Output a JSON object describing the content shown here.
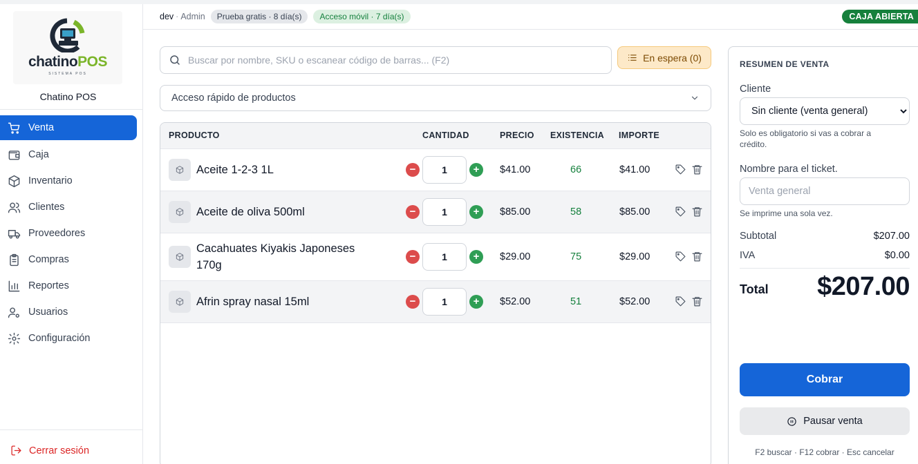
{
  "brand": {
    "logo_word_a": "chatino",
    "logo_word_b": "POS",
    "logo_sub": "SISTEMA POS",
    "name": "Chatino POS"
  },
  "sidebar": {
    "items": [
      {
        "label": "Venta",
        "icon": "cart-icon",
        "active": true
      },
      {
        "label": "Caja",
        "icon": "wallet-icon"
      },
      {
        "label": "Inventario",
        "icon": "box-icon"
      },
      {
        "label": "Clientes",
        "icon": "users-icon"
      },
      {
        "label": "Proveedores",
        "icon": "truck-icon"
      },
      {
        "label": "Compras",
        "icon": "clipboard-icon"
      },
      {
        "label": "Reportes",
        "icon": "bar-chart-icon"
      },
      {
        "label": "Usuarios",
        "icon": "user-cog-icon"
      },
      {
        "label": "Configuración",
        "icon": "gear-icon"
      }
    ],
    "logout": "Cerrar sesión"
  },
  "header": {
    "user": "dev",
    "separator": "·",
    "role": "Admin",
    "trial": "Prueba gratis · 8 día(s)",
    "mobile": "Acceso móvil · 7 día(s)",
    "cash_status": "CAJA ABIERTA"
  },
  "search": {
    "placeholder": "Buscar por nombre, SKU o escanear código de barras... (F2)",
    "value": ""
  },
  "hold_button": "En espera (0)",
  "quick_access": "Acceso rápido de productos",
  "table": {
    "headers": {
      "product": "PRODUCTO",
      "quantity": "CANTIDAD",
      "price": "PRECIO",
      "stock": "EXISTENCIA",
      "amount": "IMPORTE"
    },
    "rows": [
      {
        "name": "Aceite 1-2-3 1L",
        "qty": "1",
        "price": "$41.00",
        "stock": "66",
        "amount": "$41.00"
      },
      {
        "name": "Aceite de oliva 500ml",
        "qty": "1",
        "price": "$85.00",
        "stock": "58",
        "amount": "$85.00"
      },
      {
        "name": "Cacahuates Kiyakis Japoneses 170g",
        "qty": "1",
        "price": "$29.00",
        "stock": "75",
        "amount": "$29.00"
      },
      {
        "name": "Afrin spray nasal 15ml",
        "qty": "1",
        "price": "$52.00",
        "stock": "51",
        "amount": "$52.00"
      }
    ],
    "minus_symbol": "−",
    "plus_symbol": "+"
  },
  "summary": {
    "title": "RESUMEN DE VENTA",
    "client_label": "Cliente",
    "client_selected": "Sin cliente (venta general)",
    "client_hint": "Solo es obligatorio si vas a cobrar a crédito.",
    "ticket_label": "Nombre para el ticket.",
    "ticket_placeholder": "Venta general",
    "ticket_hint": "Se imprime una sola vez.",
    "subtotal_label": "Subtotal",
    "subtotal_value": "$207.00",
    "iva_label": "IVA",
    "iva_value": "$0.00",
    "total_label": "Total",
    "total_value": "$207.00",
    "charge_button": "Cobrar",
    "pause_button": "Pausar venta",
    "shortcuts": "F2 buscar · F12 cobrar · Esc cancelar"
  },
  "colors": {
    "accent": "#1565d8",
    "cash_open": "#16803c",
    "danger": "#dc4c4c",
    "success": "#2f9e55",
    "hold_bg": "#fde9c8"
  }
}
